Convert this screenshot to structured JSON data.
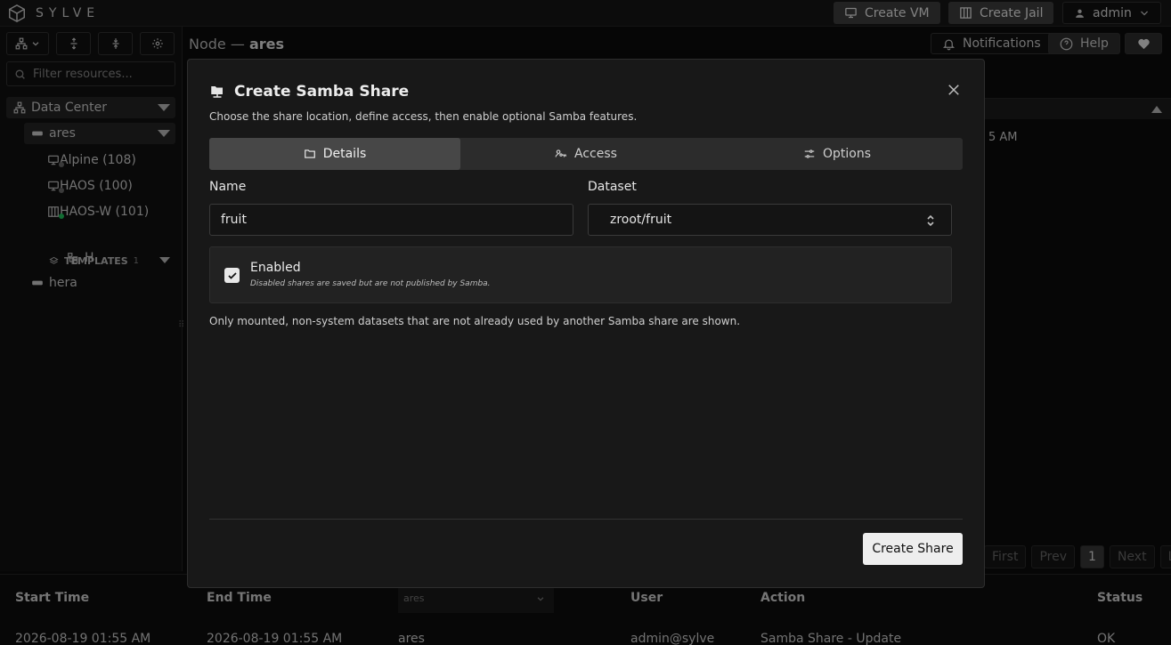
{
  "topbar": {
    "brand": "SYLVE",
    "create_vm": "Create VM",
    "create_jail": "Create Jail",
    "user": "admin"
  },
  "sidebar": {
    "filter_placeholder": "Filter resources...",
    "datacenter": "Data Center",
    "node": "ares",
    "items": [
      {
        "label": "Alpine (108)",
        "status_color": "#6b6b6b"
      },
      {
        "label": "HAOS (100)",
        "status_color": "#6b6b6b"
      },
      {
        "label": "HAOS-W (101)",
        "status_color": "#22c55e"
      }
    ],
    "templates_label": "TEMPLATES",
    "templates_count": "1",
    "template_item": "H",
    "other_node": "hera"
  },
  "header": {
    "crumb_prefix": "Node —",
    "crumb_node": "ares",
    "notifications": "Notifications",
    "help": "Help"
  },
  "background": {
    "time_fragment": "5 AM",
    "pager": {
      "first": "First",
      "prev": "Prev",
      "page": "1",
      "next": "Next",
      "last": "Last"
    },
    "log_table": {
      "headers": [
        "Start Time",
        "End Time",
        "User",
        "Action",
        "Status"
      ],
      "node_filter": "ares",
      "row": {
        "start": "2026-08-19 01:55 AM",
        "end": "2026-08-19 01:55 AM",
        "node": "ares",
        "user": "admin@sylve",
        "action": "Samba Share - Update",
        "status": "OK"
      }
    }
  },
  "modal": {
    "title": "Create Samba Share",
    "subtitle": "Choose the share location, define access, then enable optional Samba features.",
    "tabs": [
      "Details",
      "Access",
      "Options"
    ],
    "active_tab": "Details",
    "name_label": "Name",
    "name_value": "fruit",
    "dataset_label": "Dataset",
    "dataset_value": "zroot/fruit",
    "enabled_label": "Enabled",
    "enabled_checked": true,
    "enabled_desc": "Disabled shares are saved but are not published by Samba.",
    "note": "Only mounted, non-system datasets that are not already used by another Samba share are shown.",
    "submit": "Create Share"
  }
}
